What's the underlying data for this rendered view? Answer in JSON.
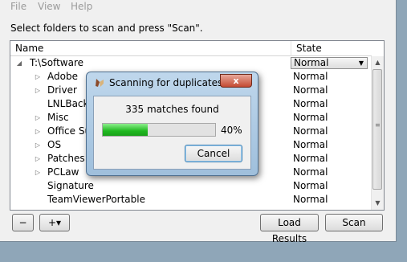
{
  "menu": {
    "file": "File",
    "view": "View",
    "help": "Help"
  },
  "instruction": "Select folders to scan and press \"Scan\".",
  "columns": {
    "name": "Name",
    "state": "State"
  },
  "root": {
    "label": "T:\\Software",
    "state": "Normal"
  },
  "rows": [
    {
      "label": "Adobe",
      "state": "Normal",
      "expandable": true
    },
    {
      "label": "Driver",
      "state": "Normal",
      "expandable": true
    },
    {
      "label": "LNLBacku",
      "state": "Normal",
      "expandable": false
    },
    {
      "label": "Misc",
      "state": "Normal",
      "expandable": true
    },
    {
      "label": "Office Su",
      "state": "Normal",
      "expandable": true
    },
    {
      "label": "OS",
      "state": "Normal",
      "expandable": true
    },
    {
      "label": "Patches",
      "state": "Normal",
      "expandable": true
    },
    {
      "label": "PCLaw",
      "state": "Normal",
      "expandable": true
    },
    {
      "label": "Signature",
      "state": "Normal",
      "expandable": false
    },
    {
      "label": "TeamViewerPortable",
      "state": "Normal",
      "expandable": false
    }
  ],
  "buttons": {
    "remove": "−",
    "add": "+▾",
    "load": "Load Results",
    "scan": "Scan"
  },
  "dialog": {
    "title": "Scanning for duplicates",
    "close": "x",
    "matches": "335 matches found",
    "progress_fraction": 0.4,
    "progress_text": "40%",
    "cancel": "Cancel"
  },
  "colors": {
    "progress": "#20b820",
    "selection_border": "#3c7fb1"
  }
}
